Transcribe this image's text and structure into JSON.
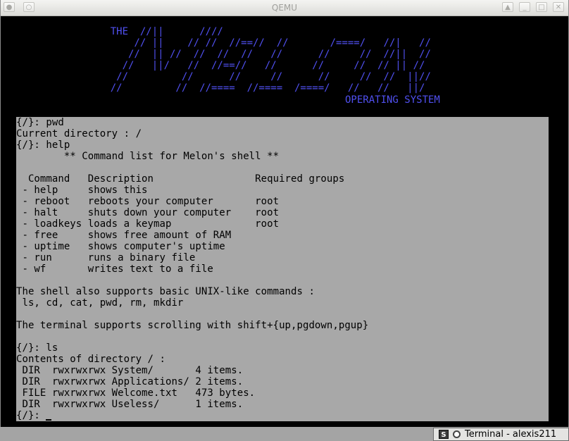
{
  "window": {
    "title": "QEMU",
    "buttons": {
      "pin": "●",
      "up": "▲",
      "minimize": "_",
      "maximize": "□",
      "close": "✕"
    }
  },
  "logo": {
    "lines": [
      "                  THE  //||      ////",
      "                      // ||    // //  //==//  //       /====/   //|   //",
      "                     //  || //  //  //  //   //      //     //  //||  //",
      "                    //   ||/   //  //==//   //      //     //  // || //",
      "                   //         //      //     //      //     //  //  ||//",
      "                  //         //  //====  //====  /====/   //   //   ||/"
    ],
    "subtitle": "OPERATING SYSTEM"
  },
  "console": {
    "lines": [
      "{/}: pwd",
      "Current directory : /",
      "{/}: help",
      "        ** Command list for Melon's shell **",
      "",
      "  Command   Description                 Required groups",
      " - help     shows this",
      " - reboot   reboots your computer       root",
      " - halt     shuts down your computer    root",
      " - loadkeys loads a keymap              root",
      " - free     shows free amount of RAM",
      " - uptime   shows computer's uptime",
      " - run      runs a binary file",
      " - wf       writes text to a file",
      "",
      "The shell also supports basic UNIX-like commands :",
      " ls, cd, cat, pwd, rm, mkdir",
      "",
      "The terminal supports scrolling with shift+{up,pgdown,pgup}",
      "",
      "{/}: ls",
      "Contents of directory / :",
      " DIR  rwxrwxrwx System/       4 items.",
      " DIR  rwxrwxrwx Applications/ 2 items.",
      " FILE rwxrwxrwx Welcome.txt   473 bytes.",
      " DIR  rwxrwxrwx Useless/      1 items."
    ],
    "prompt": "{/}: "
  },
  "taskbar": {
    "task_label": "Terminal - alexis211",
    "term_icon_glyph": "S"
  },
  "colors": {
    "logo": "#5050f0",
    "console_bg": "#a8a8a8",
    "screen_bg": "#000000"
  }
}
